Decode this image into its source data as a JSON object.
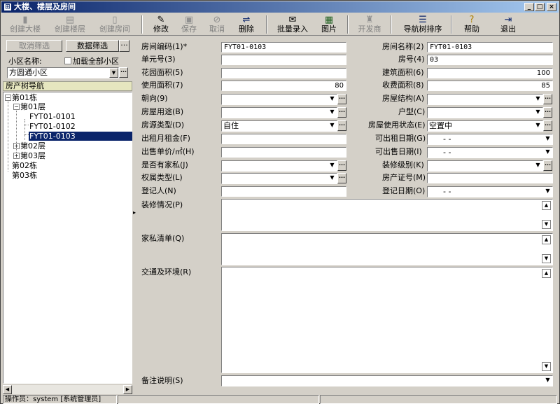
{
  "window": {
    "title": "大楼、楼层及房间"
  },
  "toolbar": {
    "create_building": "创建大楼",
    "create_floor": "创建楼层",
    "create_room": "创建房间",
    "edit": "修改",
    "save": "保存",
    "cancel": "取消",
    "delete": "删除",
    "batch_entry": "批量录入",
    "image": "图片",
    "developer": "开发商",
    "nav_sort": "导航树排序",
    "help": "帮助",
    "exit": "退出"
  },
  "filter": {
    "cancel_filter": "取消筛选",
    "data_filter": "数据筛选",
    "ellipsis": "···",
    "community_label": "小区名称:",
    "load_all_label": "加载全部小区",
    "community_value": "方圆通小区"
  },
  "tree": {
    "header": "房产树导航",
    "nodes": {
      "b1": "第01栋",
      "f1": "第01层",
      "r1": "FYT01-0101",
      "r2": "FYT01-0102",
      "r3": "FYT01-0103",
      "f2": "第02层",
      "f3": "第03层",
      "b2": "第02栋",
      "b3": "第03栋"
    }
  },
  "form": {
    "room_code": {
      "label": "房间编码(1)*",
      "value": "FYT01-0103"
    },
    "room_name": {
      "label": "房间名称(2)",
      "value": "FYT01-0103"
    },
    "unit_no": {
      "label": "单元号(3)",
      "value": ""
    },
    "room_no": {
      "label": "房号(4)",
      "value": "03"
    },
    "garden_area": {
      "label": "花园面积(5)",
      "value": ""
    },
    "building_area": {
      "label": "建筑面积(6)",
      "value": "100"
    },
    "usable_area": {
      "label": "使用面积(7)",
      "value": "80"
    },
    "charge_area": {
      "label": "收费面积(8)",
      "value": "85"
    },
    "orientation": {
      "label": "朝向(9)",
      "value": ""
    },
    "structure": {
      "label": "房屋结构(A)",
      "value": ""
    },
    "usage": {
      "label": "房屋用途(B)",
      "value": ""
    },
    "layout": {
      "label": "户型(C)",
      "value": ""
    },
    "source_type": {
      "label": "房源类型(D)",
      "value": "自住"
    },
    "use_status": {
      "label": "房屋使用状态(E)",
      "value": "空置中"
    },
    "rent": {
      "label": "出租月租金(F)",
      "value": ""
    },
    "rent_date": {
      "label": "可出租日期(G)",
      "value": "-  -"
    },
    "sale_price": {
      "label": "出售单价/㎡(H)",
      "value": ""
    },
    "sale_date": {
      "label": "可出售日期(I)",
      "value": "-  -"
    },
    "furnished": {
      "label": "是否有家私(J)",
      "value": ""
    },
    "decoration_level": {
      "label": "装修级别(K)",
      "value": ""
    },
    "ownership": {
      "label": "权属类型(L)",
      "value": ""
    },
    "cert_no": {
      "label": "房产证号(M)",
      "value": ""
    },
    "registrant": {
      "label": "登记人(N)",
      "value": ""
    },
    "reg_date": {
      "label": "登记日期(O)",
      "value": "-  -"
    },
    "decoration": {
      "label": "装修情况(P)"
    },
    "furniture": {
      "label": "家私清单(Q)"
    },
    "traffic": {
      "label": "交通及环境(R)"
    },
    "remarks": {
      "label": "备注说明(S)",
      "value": ""
    }
  },
  "status": {
    "operator": "操作员：system [系统管理员]"
  }
}
